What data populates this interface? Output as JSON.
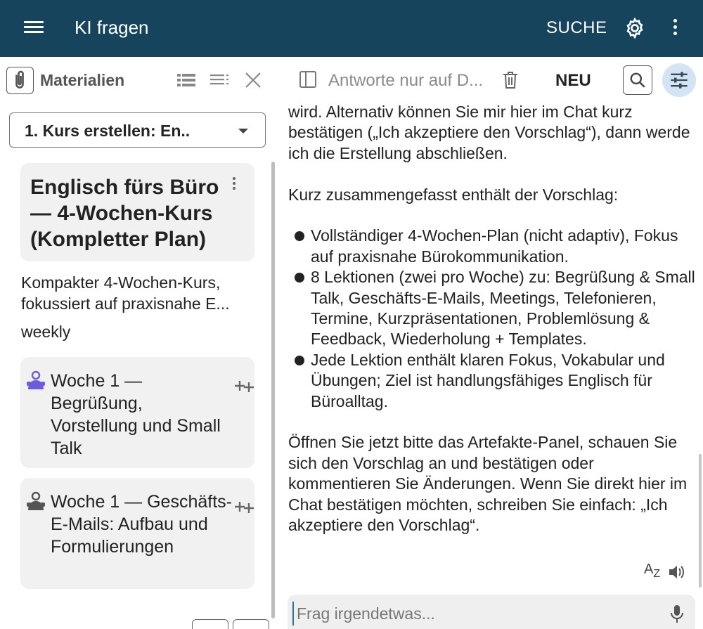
{
  "appbar": {
    "title": "KI fragen",
    "search_label": "SUCHE",
    "icons": [
      "menu-icon",
      "gear-icon",
      "more-vert-icon"
    ],
    "color": "#17445d"
  },
  "materials": {
    "header_label": "Materialien",
    "selected_course": "1. Kurs erstellen: En..",
    "course_title": "Englisch fürs Büro — 4-Wochen-Kurs (Kompletter Plan)",
    "course_description": "Kompakter 4-Wochen-Kurs, fokussiert auf praxisnahe E...",
    "frequency": "weekly",
    "lessons": [
      {
        "title": "Woche 1 — Begrüßung, Vorstellung und Small Talk",
        "avatar_color": "#6b5ce0"
      },
      {
        "title": "Woche 1 — Geschäfts-E-Mails: Aufbau und Formulierungen",
        "avatar_color": "#555555"
      }
    ]
  },
  "chat": {
    "context_placeholder": "Antworte nur auf D...",
    "new_label": "NEU",
    "paragraph1": "wird. Alternativ können Sie mir hier im Chat kurz bestätigen („Ich akzeptiere den Vorschlag“), dann werde ich die Erstellung abschließen.",
    "paragraph2": "Kurz zusammengefasst enthält der Vorschlag:",
    "bullets": [
      "Vollständiger 4-Wochen-Plan (nicht adaptiv), Fokus auf praxisnahe Bürokommunikation.",
      "8 Lektionen (zwei pro Woche) zu: Begrüßung & Small Talk, Geschäfts-E-Mails, Meetings, Telefonieren, Termine, Kurzpräsentationen, Problemlösung & Feedback, Wiederholung + Templates.",
      "Jede Lektion enthält klaren Fokus, Vokabular und Übungen; Ziel ist handlungsfähiges Englisch für Büroalltag."
    ],
    "paragraph3": "Öffnen Sie jetzt bitte das Artefakte-Panel, schauen Sie sich den Vorschlag an und bestätigen oder kommentieren Sie Änderungen. Wenn Sie direkt hier im Chat bestätigen möchten, schreiben Sie einfach: „Ich akzeptiere den Vorschlag“.",
    "translate_label_main": "A",
    "translate_label_sub": "Z",
    "input_placeholder": "Frag irgendetwas...",
    "accent": "#d5e4f4"
  }
}
